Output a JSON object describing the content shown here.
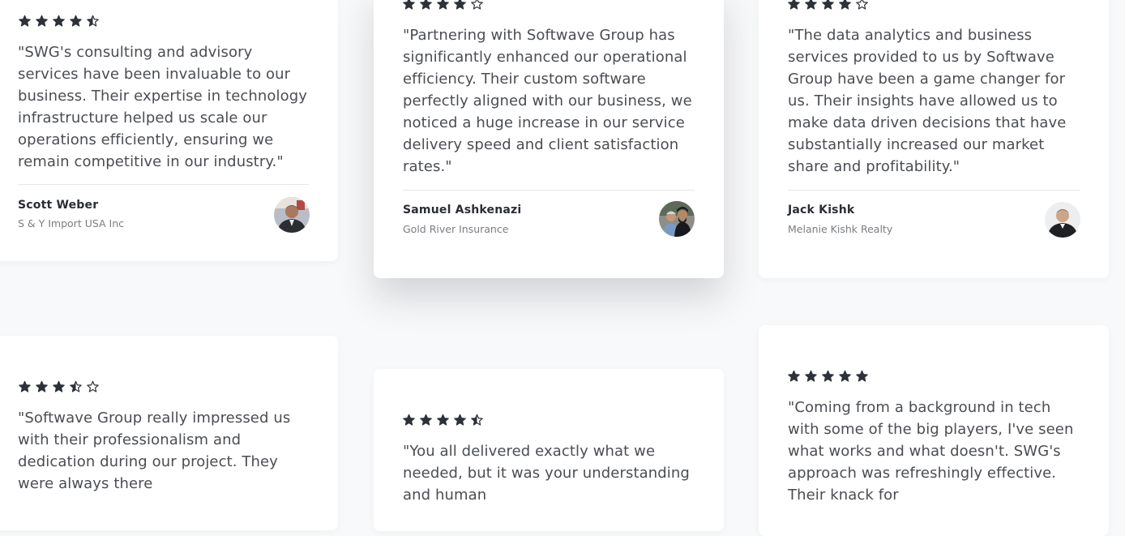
{
  "testimonials": [
    {
      "rating": 4.5,
      "quote": "\"SWG's consulting and advisory services have been invaluable to our business. Their expertise in technology infrastructure helped us scale our operations efficiently, ensuring we remain competitive in our industry.\"",
      "name": "Scott Weber",
      "company": "S & Y Import USA Inc"
    },
    {
      "rating": 4,
      "quote": "\"Partnering with Softwave Group has significantly enhanced our operational efficiency. Their custom software perfectly aligned with our business, we noticed a huge increase in our service delivery speed and client satisfaction rates.\"",
      "name": "Samuel Ashkenazi",
      "company": "Gold River Insurance"
    },
    {
      "rating": 4,
      "quote": "\"The data analytics and business services provided to us by Softwave Group have been a game changer for us. Their insights have allowed us to make data driven decisions that have substantially increased our market share and profitability.\"",
      "name": "Jack Kishk",
      "company": "Melanie Kishk Realty"
    },
    {
      "rating": 3.5,
      "quote": "\"Softwave Group really impressed us with their professionalism and dedication during our project. They were always there"
    },
    {
      "rating": 4.5,
      "quote": "\"You all delivered exactly what we needed, but it was your understanding and human"
    },
    {
      "rating": 5,
      "quote": "\"Coming from a background in tech with some of the big players, I've seen what works and what doesn't. SWG's approach was refreshingly effective. Their knack for"
    }
  ],
  "colors": {
    "page_background": "#f8f9fa",
    "card_background": "#ffffff",
    "star": "#2d3138",
    "quote_text": "#4a4d52",
    "author_name": "#2a2d33",
    "author_company": "#7a7d82",
    "divider": "#e4e6ea"
  }
}
